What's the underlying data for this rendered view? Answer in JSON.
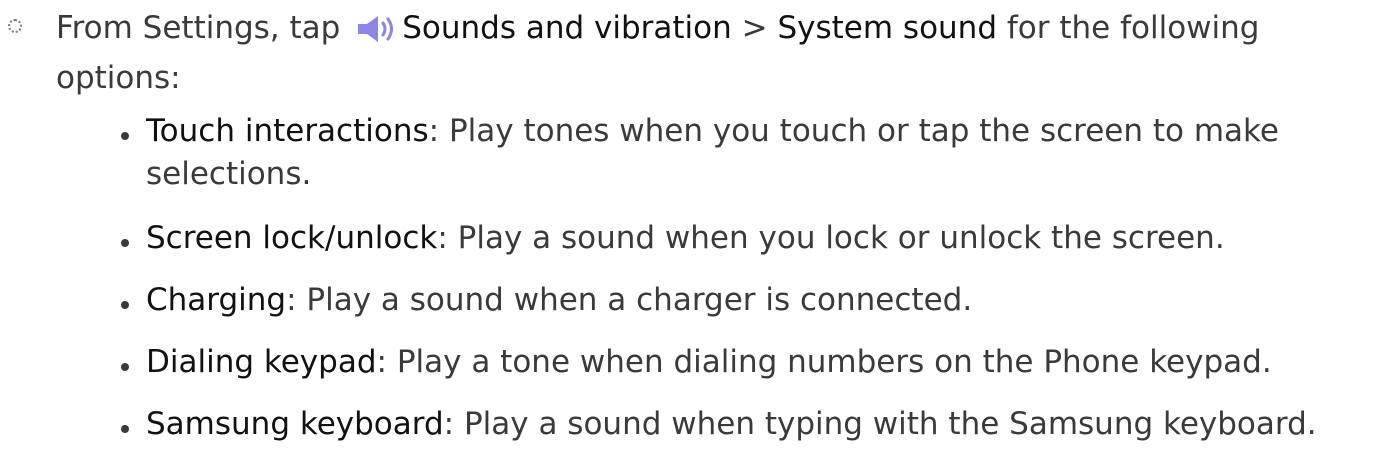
{
  "step": {
    "prefix": "From Settings, tap",
    "menu_item": "Sounds and vibration",
    "separator": ">",
    "submenu_item": "System sound",
    "suffix_line1": "for the following",
    "suffix_line2": "options:",
    "icon": "speaker-icon",
    "icon_color": "#8d86e6"
  },
  "items": [
    {
      "term": "Touch interactions",
      "sep": ":",
      "desc_line1": " Play tones when you touch or tap the screen to make",
      "desc_line2": "selections."
    },
    {
      "term": "Screen lock/unlock",
      "sep": ":",
      "desc_line1": " Play a sound when you lock or unlock the screen."
    },
    {
      "term": "Charging",
      "sep": ":",
      "desc_line1": " Play a sound when a charger is connected."
    },
    {
      "term": "Dialing keypad",
      "sep": ":",
      "desc_line1": " Play a tone when dialing numbers on the Phone keypad."
    },
    {
      "term": "Samsung keyboard",
      "sep": ":",
      "desc_line1": " Play a sound when typing with the Samsung keyboard."
    }
  ]
}
